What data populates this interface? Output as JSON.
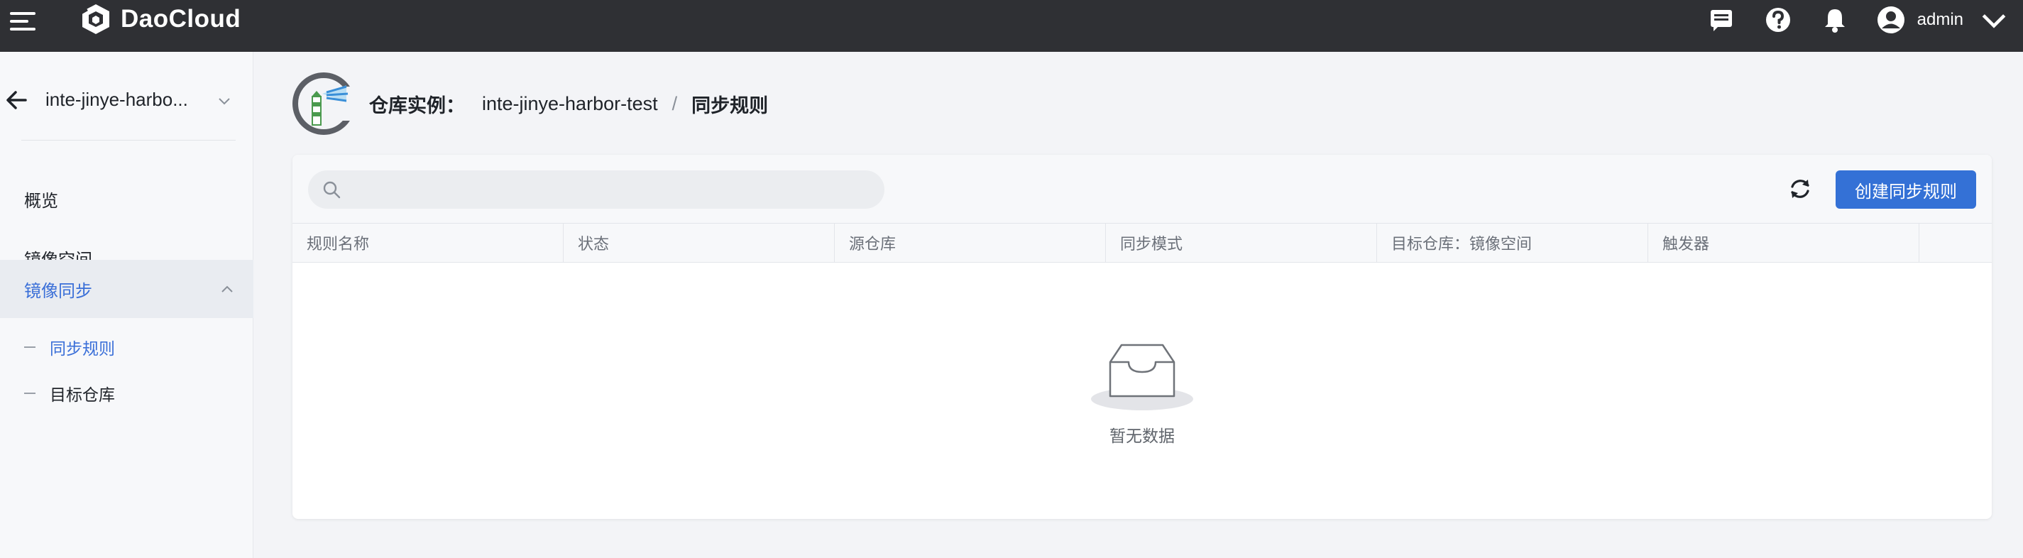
{
  "app": {
    "brand": "DaoCloud",
    "user": {
      "name": "admin"
    }
  },
  "sidebar": {
    "instance_name": "inte-jinye-harbo...",
    "items": [
      {
        "label": "概览"
      },
      {
        "label": "镜像空间"
      },
      {
        "label": "镜像同步"
      }
    ],
    "sub_items": [
      {
        "label": "同步规则"
      },
      {
        "label": "目标仓库"
      }
    ]
  },
  "breadcrumb": {
    "label": "仓库实例：",
    "instance": "inte-jinye-harbor-test",
    "separator": "/",
    "current": "同步规则"
  },
  "toolbar": {
    "search_placeholder": "",
    "create_label": "创建同步规则"
  },
  "table": {
    "columns": [
      "规则名称",
      "状态",
      "源仓库",
      "同步模式",
      "目标仓库：镜像空间",
      "触发器"
    ],
    "rows": []
  },
  "empty": {
    "text": "暂无数据"
  },
  "colors": {
    "topbar": "#2f3034",
    "accent": "#3471d6",
    "active_nav_text": "#3a6fd8",
    "sidebar_bg": "#f7f8fa",
    "page_bg": "#f3f4f7"
  },
  "icons": {
    "menu": "hamburger-icon",
    "logo": "daocloud-logo-icon",
    "message": "message-icon",
    "help": "help-icon",
    "notification": "bell-icon",
    "user": "user-avatar-icon",
    "back": "arrow-left-icon",
    "search": "search-icon",
    "refresh": "refresh-icon",
    "empty": "empty-inbox-icon"
  }
}
